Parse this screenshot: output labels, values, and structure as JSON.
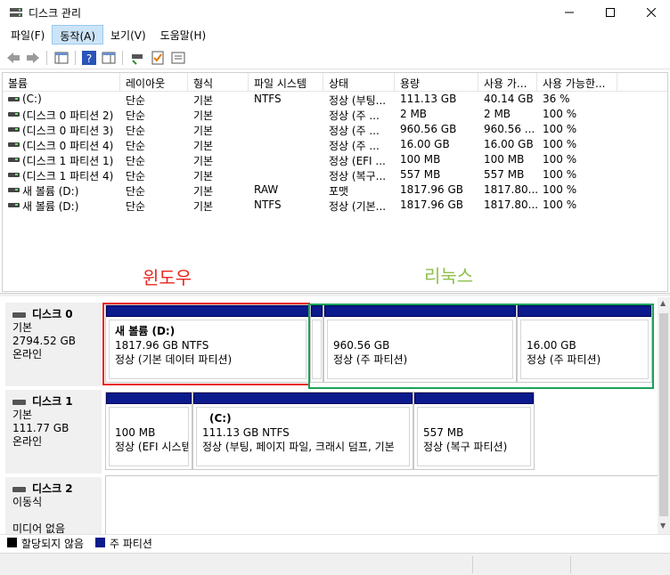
{
  "window": {
    "title": "디스크 관리",
    "minimize": "—",
    "maximize": "☐",
    "close": "✕"
  },
  "menu": [
    "파일(F)",
    "동작(A)",
    "보기(V)",
    "도움말(H)"
  ],
  "volume_list": {
    "columns": [
      "볼륨",
      "레이아웃",
      "형식",
      "파일 시스템",
      "상태",
      "용량",
      "사용 가...",
      "사용 가능한..."
    ],
    "rows": [
      [
        "(C:)",
        "단순",
        "기본",
        "NTFS",
        "정상 (부팅...",
        "111.13 GB",
        "40.14 GB",
        "36 %"
      ],
      [
        "(디스크 0 파티션 2)",
        "단순",
        "기본",
        "",
        "정상 (주 ...",
        "2 MB",
        "2 MB",
        "100 %"
      ],
      [
        "(디스크 0 파티션 3)",
        "단순",
        "기본",
        "",
        "정상 (주 ...",
        "960.56 GB",
        "960.56 ...",
        "100 %"
      ],
      [
        "(디스크 0 파티션 4)",
        "단순",
        "기본",
        "",
        "정상 (주 ...",
        "16.00 GB",
        "16.00 GB",
        "100 %"
      ],
      [
        "(디스크 1 파티션 1)",
        "단순",
        "기본",
        "",
        "정상 (EFI ...",
        "100 MB",
        "100 MB",
        "100 %"
      ],
      [
        "(디스크 1 파티션 4)",
        "단순",
        "기본",
        "",
        "정상 (복구...",
        "557 MB",
        "557 MB",
        "100 %"
      ],
      [
        "새 볼륨 (D:)",
        "단순",
        "기본",
        "RAW",
        "포맷",
        "1817.96 GB",
        "1817.80...",
        "100 %"
      ],
      [
        "새 볼륨 (D:)",
        "단순",
        "기본",
        "NTFS",
        "정상 (기본...",
        "1817.96 GB",
        "1817.80...",
        "100 %"
      ]
    ]
  },
  "annotations": {
    "windows": "윈도우",
    "linux": "리눅스"
  },
  "disks": [
    {
      "name": "디스크 0",
      "type": "기본",
      "size": "2794.52 GB",
      "status": "온라인",
      "partitions": [
        {
          "name": "새 볼륨  (D:)",
          "size": "1817.96 GB NTFS",
          "status": "정상 (기본 데이터 파티션)"
        },
        {
          "name": "",
          "size": "",
          "status": ""
        },
        {
          "name": "",
          "size": "960.56 GB",
          "status": "정상 (주 파티션)"
        },
        {
          "name": "",
          "size": "16.00 GB",
          "status": "정상 (주 파티션)"
        }
      ]
    },
    {
      "name": "디스크 1",
      "type": "기본",
      "size": "111.77 GB",
      "status": "온라인",
      "partitions": [
        {
          "name": "",
          "size": "100 MB",
          "status": "정상 (EFI 시스템"
        },
        {
          "name": "(C:)",
          "size": "111.13 GB NTFS",
          "status": "정상 (부팅, 페이지 파일, 크래시 덤프, 기본"
        },
        {
          "name": "",
          "size": "557 MB",
          "status": "정상 (복구 파티션)"
        }
      ]
    },
    {
      "name": "디스크 2",
      "type": "이동식",
      "size": "",
      "status": "미디어 없음"
    }
  ],
  "legend": {
    "unallocated": "할당되지 않음",
    "primary": "주 파티션",
    "unallocated_color": "#000000",
    "primary_color": "#0b1a8c"
  },
  "colors": {
    "windows_box": "#e8251e",
    "linux_box": "#1aa35a",
    "linux_text": "#8fc04a"
  }
}
